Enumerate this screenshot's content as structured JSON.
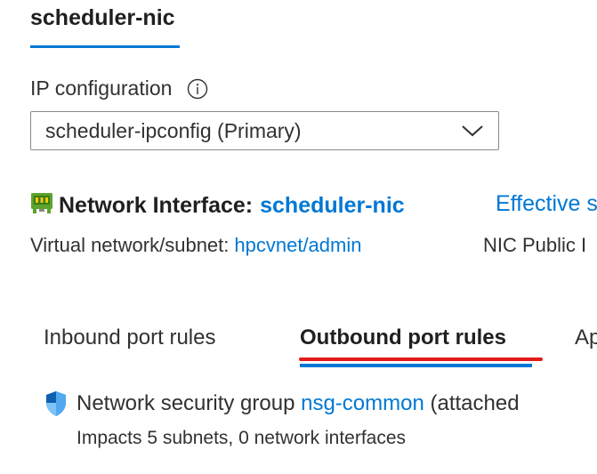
{
  "header": {
    "tab_title": "scheduler-nic"
  },
  "ip_configuration": {
    "label": "IP configuration",
    "selected": "scheduler-ipconfig (Primary)"
  },
  "network_interface": {
    "label": "Network Interface:",
    "name": "scheduler-nic",
    "effective_link": "Effective s",
    "vnet_label": "Virtual network/subnet:",
    "vnet_value": "hpcvnet/admin",
    "nic_public_label": "NIC Public I"
  },
  "tabs": [
    {
      "label": "Inbound port rules",
      "active": false
    },
    {
      "label": "Outbound port rules",
      "active": true
    },
    {
      "label": "Ap",
      "active": false
    }
  ],
  "nsg": {
    "prefix": "Network security group",
    "name": "nsg-common",
    "suffix": "(attached",
    "impacts": "Impacts 5 subnets, 0 network interfaces"
  },
  "colors": {
    "accent": "#0078d4",
    "annotation": "#e31b1b",
    "text": "#323130"
  },
  "icons": [
    "info-icon",
    "chevron-down-icon",
    "network-interface-icon",
    "shield-icon"
  ]
}
